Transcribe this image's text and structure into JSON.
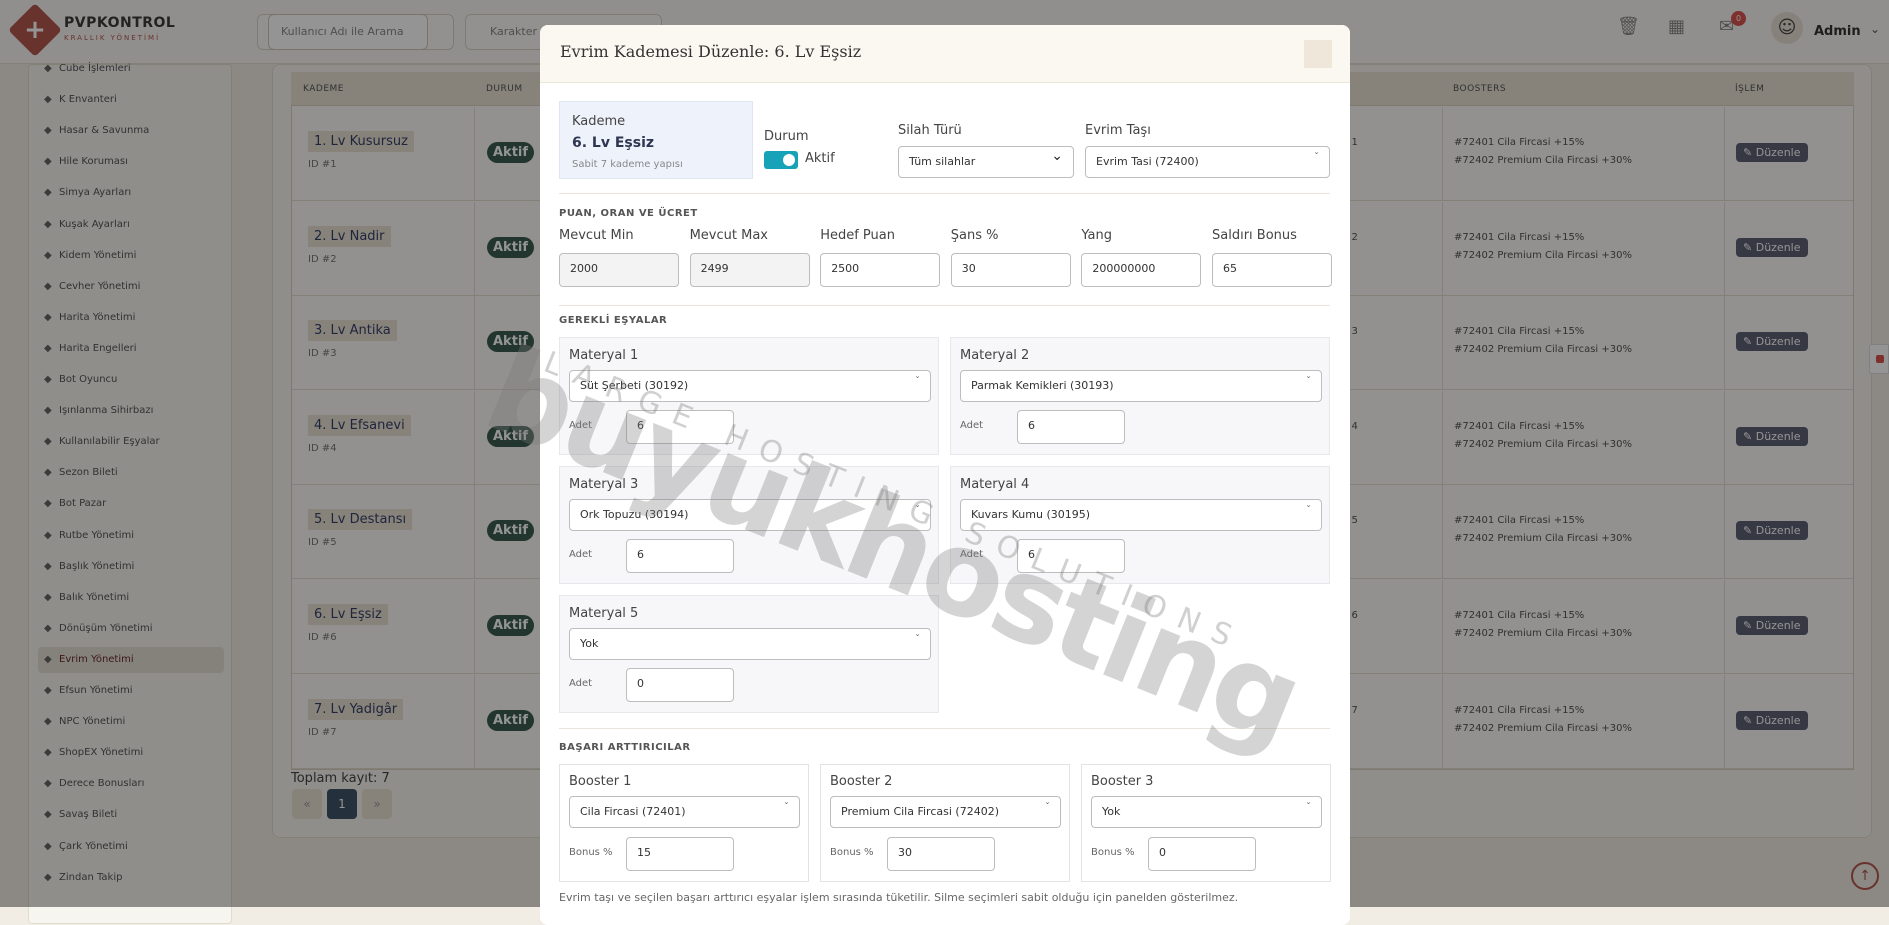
{
  "app": {
    "name": "PVPKONTROL",
    "subtitle": "KRALLIK YÖNETİMİ"
  },
  "topbar": {
    "search_placeholder": "Kullanıcı Adı ile Arama",
    "char_placeholder": "Karakter",
    "notifications_count": "0",
    "user_name": "Admin"
  },
  "sidebar": {
    "items": [
      {
        "label": "Cube İşlemleri",
        "icon": "cube-icon"
      },
      {
        "label": "K Envanteri",
        "icon": "box-icon"
      },
      {
        "label": "Hasar & Savunma",
        "icon": "shield-icon"
      },
      {
        "label": "Hile Koruması",
        "icon": "shield-icon"
      },
      {
        "label": "Simya Ayarları",
        "icon": "diamond-icon"
      },
      {
        "label": "Kuşak Ayarları",
        "icon": "diamond-icon"
      },
      {
        "label": "Kidem Yönetimi",
        "icon": "star-icon"
      },
      {
        "label": "Cevher Yönetimi",
        "icon": "gem-icon"
      },
      {
        "label": "Harita Yönetimi",
        "icon": "map-icon"
      },
      {
        "label": "Harita Engelleri",
        "icon": "block-icon"
      },
      {
        "label": "Bot Oyuncu",
        "icon": "robot-icon"
      },
      {
        "label": "Işınlanma Sihirbazı",
        "icon": "magic-icon"
      },
      {
        "label": "Kullanılabilir Eşyalar",
        "icon": "grid-icon"
      },
      {
        "label": "Sezon Bileti",
        "icon": "ticket-icon"
      },
      {
        "label": "Bot Pazar",
        "icon": "shop-icon"
      },
      {
        "label": "Rutbe Yönetimi",
        "icon": "star-icon"
      },
      {
        "label": "Başlık Yönetimi",
        "icon": "heading-icon"
      },
      {
        "label": "Balık Yönetimi",
        "icon": "anchor-icon"
      },
      {
        "label": "Dönüşüm Yönetimi",
        "icon": "shuffle-icon"
      },
      {
        "label": "Evrim Yönetimi",
        "icon": "wand-icon",
        "active": true
      },
      {
        "label": "Efsun Yönetimi",
        "icon": "wand-icon"
      },
      {
        "label": "NPC Yönetimi",
        "icon": "user-icon"
      },
      {
        "label": "ShopEX Yönetimi",
        "icon": "shop-icon"
      },
      {
        "label": "Derece Bonusları",
        "icon": "list-icon"
      },
      {
        "label": "Savaş Bileti",
        "icon": "ticket-icon"
      },
      {
        "label": "Çark Yönetimi",
        "icon": "wheel-icon"
      },
      {
        "label": "Zindan Takip",
        "icon": "pin-icon"
      }
    ]
  },
  "table": {
    "headers": [
      "KADEME",
      "DURUM",
      "BOOSTERS",
      "İŞLEM"
    ],
    "rows": [
      {
        "name": "1. Lv Kusursuz",
        "id": "ID #1",
        "status": "Aktif",
        "partial": ": 1"
      },
      {
        "name": "2. Lv Nadir",
        "id": "ID #2",
        "status": "Aktif",
        "partial": ": 2"
      },
      {
        "name": "3. Lv Antika",
        "id": "ID #3",
        "status": "Aktif",
        "partial": ": 3"
      },
      {
        "name": "4. Lv Efsanevi",
        "id": "ID #4",
        "status": "Aktif",
        "partial": ": 4"
      },
      {
        "name": "5. Lv Destansı",
        "id": "ID #5",
        "status": "Aktif",
        "partial": ": 5"
      },
      {
        "name": "6. Lv Eşsiz",
        "id": "ID #6",
        "status": "Aktif",
        "partial": ": 6"
      },
      {
        "name": "7. Lv Yadigâr",
        "id": "ID #7",
        "status": "Aktif",
        "partial": ": 7"
      }
    ],
    "booster_line_1": "#72401 Cila Fircasi +15%",
    "booster_line_2": "#72402 Premium Cila Fircasi +30%",
    "edit_label": "Düzenle",
    "total": "Toplam kayıt: 7",
    "pagination": {
      "prev": "«",
      "current": "1",
      "next": "»"
    }
  },
  "modal": {
    "title": "Evrim Kademesi Düzenle: 6. Lv Eşsiz",
    "kademe_label": "Kademe",
    "kademe_value": "6. Lv Eşsiz",
    "kademe_sub": "Sabit 7 kademe yapısı",
    "durum_label": "Durum",
    "durum_value": "Aktif",
    "silah_label": "Silah Türü",
    "silah_value": "Tüm silahlar",
    "evrim_tasi_label": "Evrim Taşı",
    "evrim_tasi_value": "Evrim Tasi (72400)",
    "section_points": "PUAN, ORAN VE ÜCRET",
    "points": [
      {
        "label": "Mevcut Min",
        "value": "2000"
      },
      {
        "label": "Mevcut Max",
        "value": "2499"
      },
      {
        "label": "Hedef Puan",
        "value": "2500"
      },
      {
        "label": "Şans %",
        "value": "30"
      },
      {
        "label": "Yang",
        "value": "200000000"
      },
      {
        "label": "Saldırı Bonus",
        "value": "65"
      }
    ],
    "section_items": "GEREKLİ EŞYALAR",
    "adet_label": "Adet",
    "materials": [
      {
        "label": "Materyal 1",
        "value": "Süt Şerbeti (30192)",
        "adet": "6"
      },
      {
        "label": "Materyal 2",
        "value": "Parmak Kemikleri (30193)",
        "adet": "6"
      },
      {
        "label": "Materyal 3",
        "value": "Ork Topuzu (30194)",
        "adet": "6"
      },
      {
        "label": "Materyal 4",
        "value": "Kuvars Kumu (30195)",
        "adet": "6"
      },
      {
        "label": "Materyal 5",
        "value": "Yok",
        "adet": "0"
      }
    ],
    "section_boosters": "BAŞARI ARTTIRICILAR",
    "bonus_label": "Bonus %",
    "boosters": [
      {
        "label": "Booster 1",
        "value": "Cila Fircasi (72401)",
        "bonus": "15"
      },
      {
        "label": "Booster 2",
        "value": "Premium Cila Fircasi (72402)",
        "bonus": "30"
      },
      {
        "label": "Booster 3",
        "value": "Yok",
        "bonus": "0"
      }
    ],
    "footnote": "Evrim taşı ve seçilen başarı arttırıcı eşyalar işlem sırasında tüketilir. Silme seçimleri sabit olduğu için panelden gösterilmez."
  },
  "watermark": {
    "main": "buyukhosting",
    "sub": "LARGE HOSTING SOLUTIONS"
  },
  "colors": {
    "accent": "#b4574f",
    "status": "#3c5c52",
    "toggle": "#17a2b8"
  }
}
